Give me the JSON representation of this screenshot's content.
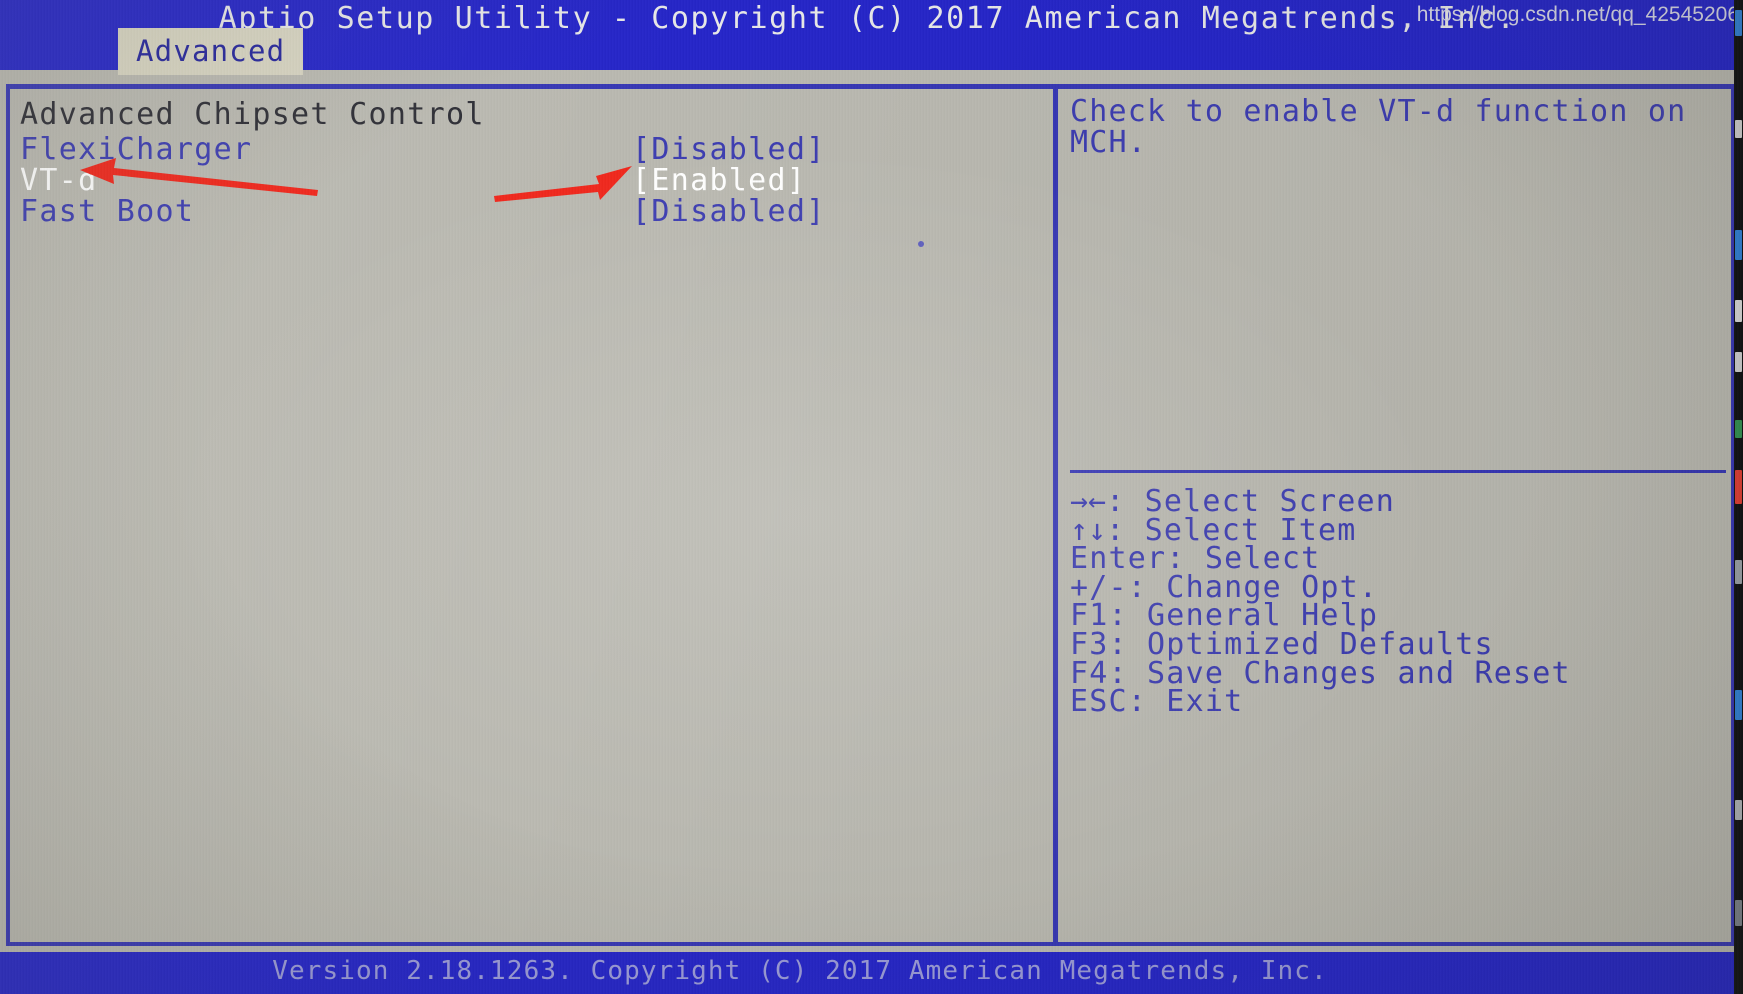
{
  "window": {
    "title": "Aptio Setup Utility - Copyright (C) 2017 American Megatrends, Inc.",
    "footer": "Version 2.18.1263. Copyright (C) 2017 American Megatrends, Inc.",
    "watermark": "https://blog.csdn.net/qq_42545206"
  },
  "tabs": [
    {
      "label": "Advanced",
      "active": true
    }
  ],
  "settings": {
    "group_title": "Advanced Chipset Control",
    "rows": [
      {
        "label": "FlexiCharger",
        "value": "[Disabled]",
        "selected": false
      },
      {
        "label": "VT-d",
        "value": "[Enabled]",
        "selected": true
      },
      {
        "label": "Fast Boot",
        "value": "[Disabled]",
        "selected": false
      }
    ]
  },
  "help": {
    "description": "Check to enable VT-d function on MCH.",
    "keys": [
      {
        "glyph": "→←",
        "text": ": Select Screen"
      },
      {
        "glyph": "↑↓",
        "text": ": Select Item"
      },
      {
        "glyph": "",
        "text": "Enter: Select"
      },
      {
        "glyph": "",
        "text": "+/-: Change Opt."
      },
      {
        "glyph": "",
        "text": "F1: General Help"
      },
      {
        "glyph": "",
        "text": "F3: Optimized Defaults"
      },
      {
        "glyph": "",
        "text": "F4: Save Changes and Reset"
      },
      {
        "glyph": "",
        "text": "ESC: Exit"
      }
    ]
  },
  "annotations": {
    "arrow_color": "#f02318",
    "arrows": [
      {
        "name": "arrow-to-vt-d-label",
        "points_at": "VT-d"
      },
      {
        "name": "arrow-to-vt-d-value",
        "points_at": "[Enabled]"
      }
    ]
  },
  "colors": {
    "screen_bg": "#b9b8b0",
    "bar_blue": "#2222c8",
    "text_blue": "#3a3ab0",
    "selected_text": "#ffffff",
    "group_title": "#2b2b33",
    "border_blue": "#3434b4",
    "tab_bg": "#d8d5c2"
  }
}
